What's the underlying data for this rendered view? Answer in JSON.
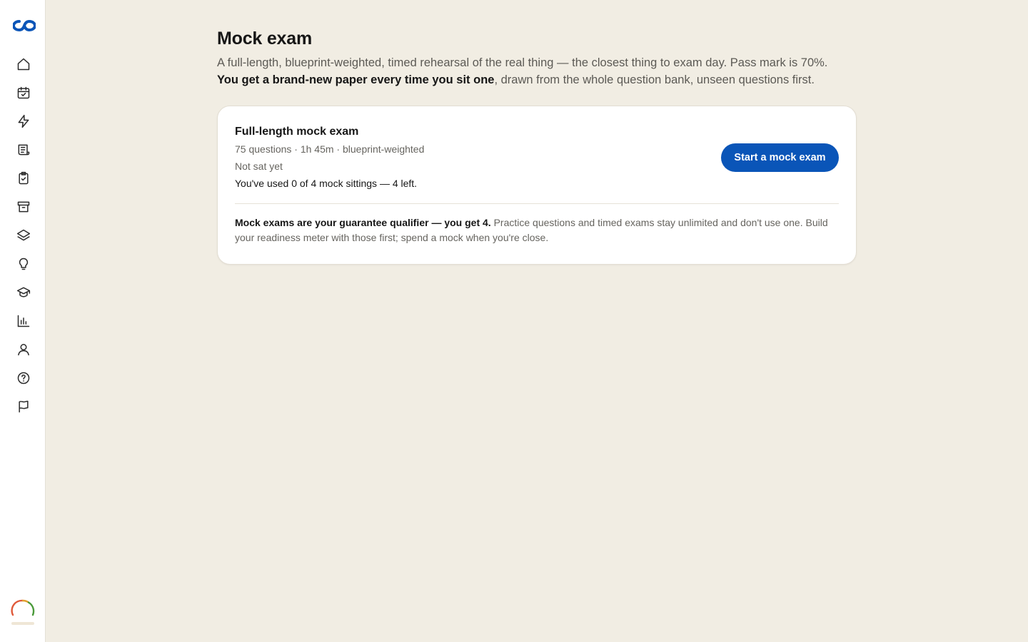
{
  "sidebar": {
    "items": [
      {
        "icon": "home-icon",
        "label": "Home"
      },
      {
        "icon": "calendar-check-icon",
        "label": "Study plan"
      },
      {
        "icon": "lightning-icon",
        "label": "Quick practice"
      },
      {
        "icon": "scroll-icon",
        "label": "Practice exams"
      },
      {
        "icon": "clipboard-check-icon",
        "label": "Mock exam"
      },
      {
        "icon": "archive-icon",
        "label": "Archive"
      },
      {
        "icon": "layers-icon",
        "label": "Flashcards"
      },
      {
        "icon": "lightbulb-icon",
        "label": "Tips"
      },
      {
        "icon": "graduation-cap-icon",
        "label": "Learn"
      },
      {
        "icon": "bar-chart-icon",
        "label": "Stats"
      },
      {
        "icon": "user-icon",
        "label": "Profile"
      },
      {
        "icon": "help-circle-icon",
        "label": "Help"
      },
      {
        "icon": "flag-icon",
        "label": "Report"
      }
    ]
  },
  "main": {
    "title": "Mock exam",
    "intro_line1": "A full-length, blueprint-weighted, timed rehearsal of the real thing — the closest thing to exam day. Pass mark is 70%.",
    "intro_bold": "You get a brand-new paper every time you sit one",
    "intro_rest": ", drawn from the whole question bank, unseen questions first."
  },
  "card": {
    "title": "Full-length mock exam",
    "meta": "75 questions · 1h 45m · blueprint-weighted",
    "status": "Not sat yet",
    "usage": "You've used 0 of 4 mock sittings — 4 left.",
    "button_label": "Start a mock exam",
    "note_bold": "Mock exams are your guarantee qualifier — you get 4.",
    "note_rest": " Practice questions and timed exams stay unlimited and don't use one. Build your readiness meter with those first; spend a mock when you're close."
  },
  "colors": {
    "accent": "#0a55b8",
    "background": "#f1ede3",
    "card": "#ffffff"
  }
}
